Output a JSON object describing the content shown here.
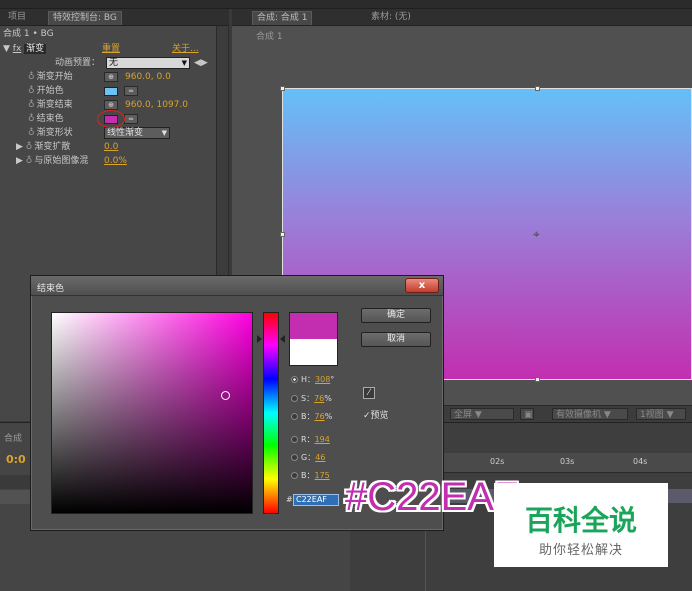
{
  "tabs": {
    "project": "项目",
    "effect_controls": "特效控制台: BG",
    "composition": "合成: 合成 1",
    "footage": "素材: (无)"
  },
  "effect_panel": {
    "breadcrumb": "合成 1 • BG",
    "fx": "fx",
    "effect_name": "渐变",
    "reset": "重置",
    "about": "关于...",
    "animation_preset_label": "动画预置：",
    "animation_preset_value": "无",
    "properties": [
      {
        "label": "渐变开始",
        "value": "960.0, 0.0"
      },
      {
        "label": "开始色",
        "value": ""
      },
      {
        "label": "渐变结束",
        "value": "960.0, 1097.0"
      },
      {
        "label": "结束色",
        "value": ""
      },
      {
        "label": "渐变形状",
        "value": "线性渐变"
      },
      {
        "label": "渐变扩散",
        "value": "0.0"
      },
      {
        "label": "与原始图像混",
        "value": "0.0%"
      }
    ],
    "start_color": "#6ec3f5",
    "end_color": "#c22eaf"
  },
  "viewer": {
    "comp_tab_label": "合成 1",
    "footer": {
      "view_mode": "全屏",
      "camera": "有效摄像机",
      "views": "1视图"
    }
  },
  "timeline": {
    "tab": "合成",
    "timecode": "0:0",
    "ticks": [
      "02s",
      "03s",
      "04s"
    ]
  },
  "color_dialog": {
    "title": "结束色",
    "ok": "确定",
    "cancel": "取消",
    "preview_label": "预览",
    "h_label": "H：",
    "h_value": "308",
    "h_unit": "°",
    "s_label": "S：",
    "s_value": "76",
    "s_unit": "%",
    "b_label": "B：",
    "b_value": "76",
    "b_unit": "%",
    "r_label": "R：",
    "r_value": "194",
    "g_label": "G：",
    "g_value": "46",
    "bl_label": "B：",
    "bl_value": "175",
    "hash": "#",
    "hex": "C22EAF",
    "current_color": "#c22eaf",
    "original_color": "#ffffff",
    "close_glyph": "x"
  },
  "annotation": {
    "hex_callout": "#C22EAF"
  },
  "watermark": {
    "title": "百科全说",
    "subtitle": "助你轻松解决"
  }
}
